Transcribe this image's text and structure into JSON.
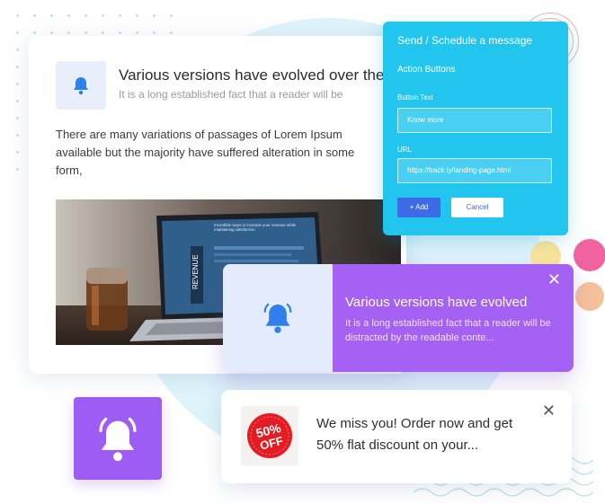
{
  "article": {
    "title": "Various versions have evolved over the...",
    "subtitle": "It is a long established fact that a reader will be",
    "body": "There are many variations of passages of Lorem Ipsum available but the majority have suffered alteration in some form,",
    "photo_screen_text": "REVENUE",
    "photo_screen_caption": "Incredible ways to increase your revenue while maintaining satisfaction",
    "icon": "bell-icon"
  },
  "schedule_panel": {
    "title": "Send / Schedule a message",
    "section": "Action Buttons",
    "button_text_label": "Button Text",
    "button_text_value": "Know more",
    "url_label": "URL",
    "url_value": "https://track.ly/landing-page.html",
    "add_label": "+ Add",
    "cancel_label": "Cancel"
  },
  "notification": {
    "title": "Various versions have evolved",
    "message": "It is a long established fact that a reader will be distracted by the readable conte...",
    "close": "✕",
    "icon": "bell-icon"
  },
  "offer": {
    "badge_line1": "50%",
    "badge_line2": "OFF",
    "message": "We miss you! Order now and get 50% flat discount on your...",
    "close": "✕"
  },
  "colors": {
    "accent_blue": "#22c5ee",
    "purple": "#a461f4",
    "bell_blue": "#2f80ed",
    "offer_red": "#e31b23"
  }
}
